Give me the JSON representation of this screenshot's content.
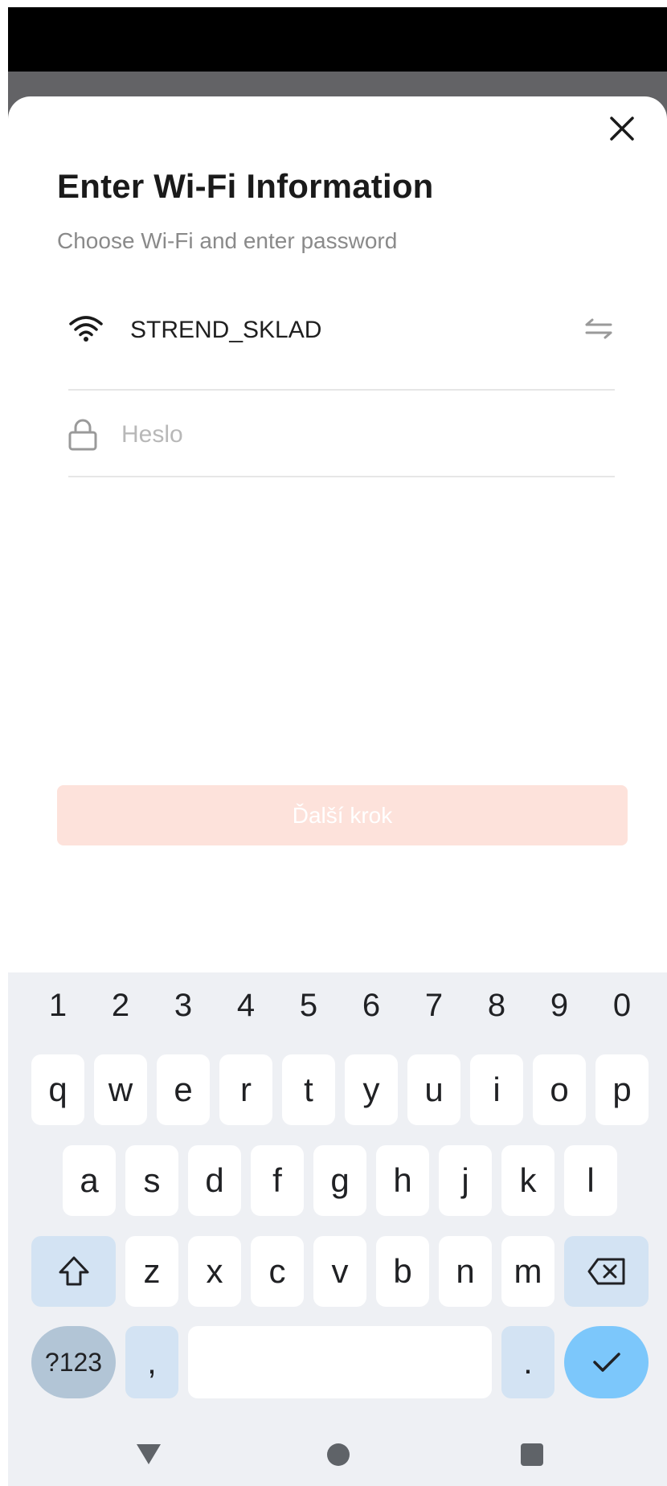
{
  "dialog": {
    "title": "Enter Wi-Fi Information",
    "subtitle": "Choose Wi-Fi and enter password",
    "wifi_name": "STREND_SKLAD",
    "password_placeholder": "Heslo",
    "password_value": "",
    "next_button": "Ďalší krok",
    "colors": {
      "next_button_bg": "#fde2db",
      "title": "#1a1a1a",
      "subtitle": "#8a8a8a"
    }
  },
  "keyboard": {
    "numbers": [
      "1",
      "2",
      "3",
      "4",
      "5",
      "6",
      "7",
      "8",
      "9",
      "0"
    ],
    "row1": [
      "q",
      "w",
      "e",
      "r",
      "t",
      "y",
      "u",
      "i",
      "o",
      "p"
    ],
    "row2": [
      "a",
      "s",
      "d",
      "f",
      "g",
      "h",
      "j",
      "k",
      "l"
    ],
    "row3": [
      "z",
      "x",
      "c",
      "v",
      "b",
      "n",
      "m"
    ],
    "symbols_key": "?123",
    "comma_key": ",",
    "period_key": ".",
    "colors": {
      "background": "#eef0f4",
      "function_key": "#d3e3f3",
      "enter_key": "#7cc7fb"
    }
  },
  "icons": {
    "close": "close-icon",
    "wifi": "wifi-icon",
    "switch": "switch-network-icon",
    "lock": "lock-icon",
    "shift": "shift-icon",
    "backspace": "backspace-icon",
    "enter": "checkmark-icon",
    "nav_back": "back-triangle-icon",
    "nav_home": "home-circle-icon",
    "nav_recents": "recents-square-icon"
  }
}
